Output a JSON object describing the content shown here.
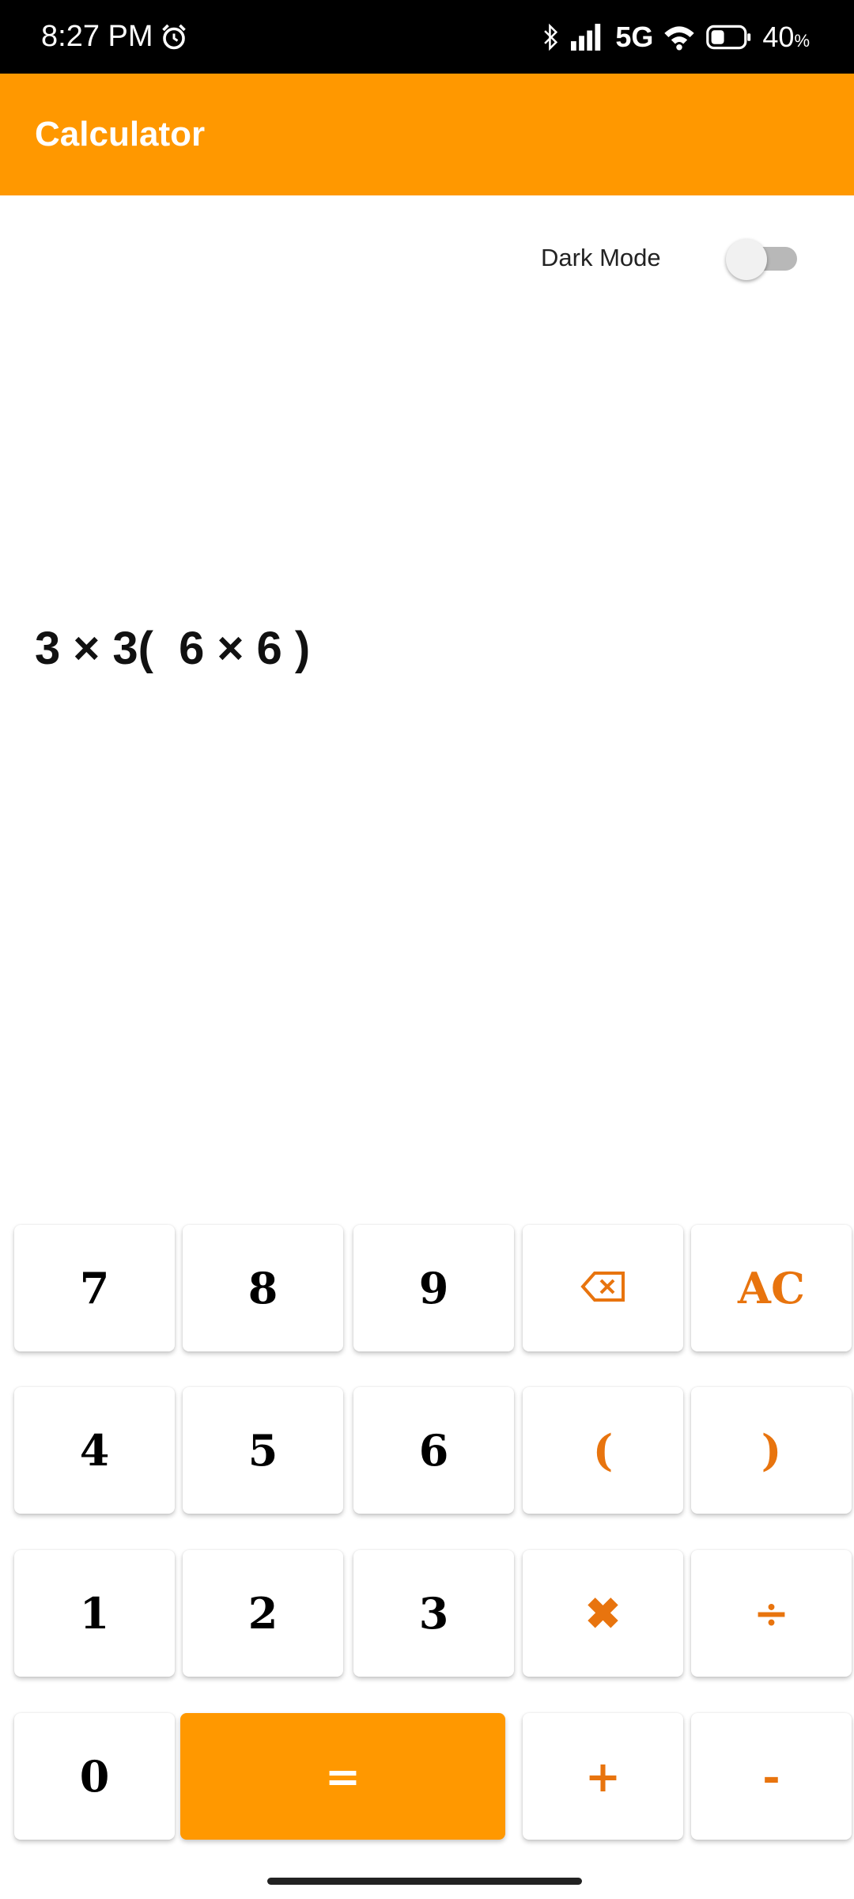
{
  "status_bar": {
    "time": "8:27 PM",
    "network": "5G",
    "battery_percent": "40",
    "battery_symbol": "%",
    "icons": [
      "alarm-icon",
      "bluetooth-icon",
      "signal-icon",
      "wifi-icon",
      "battery-icon"
    ]
  },
  "app_bar": {
    "title": "Calculator",
    "color": "#FF9800"
  },
  "settings": {
    "dark_mode_label": "Dark Mode",
    "dark_mode_enabled": false
  },
  "display": {
    "expression": "3 × 3(  6 × 6 )"
  },
  "keypad": {
    "k7": "7",
    "k8": "8",
    "k9": "9",
    "backspace_icon": "backspace-icon",
    "ac": "AC",
    "k4": "4",
    "k5": "5",
    "k6": "6",
    "open_paren": "(",
    "close_paren": ")",
    "k1": "1",
    "k2": "2",
    "k3": "3",
    "multiply": "✖",
    "divide": "÷",
    "k0": "0",
    "equals": "=",
    "plus": "+",
    "minus": "-",
    "accent_color": "#E8740E"
  }
}
